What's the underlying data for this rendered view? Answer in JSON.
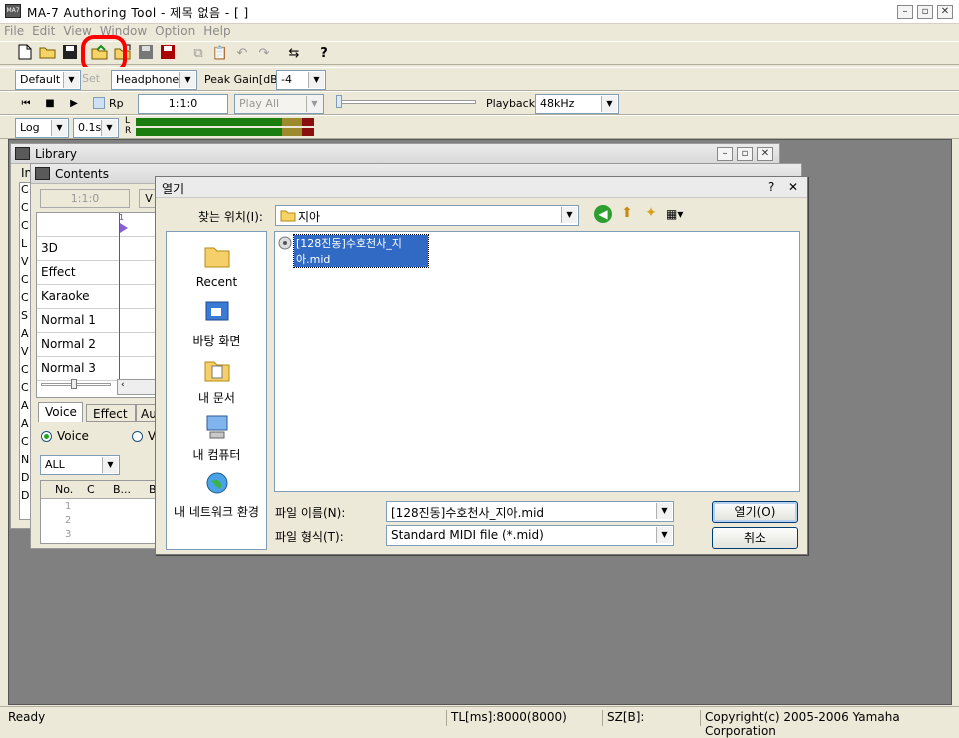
{
  "app": {
    "title": "MA-7 Authoring Tool - 제목 없음 - [ ]",
    "icon": "app-icon"
  },
  "menu": [
    "File",
    "Edit",
    "View",
    "Window",
    "Option",
    "Help"
  ],
  "toolbar2": {
    "mode": "Default",
    "set_label": "Set",
    "output": "Headphone",
    "peak_gain_label": "Peak Gain[dB]",
    "peak_gain_value": "-4"
  },
  "toolbar3": {
    "rp_label": "Rp",
    "position": "1:1:0",
    "play_mode": "Play All",
    "playback_label": "Playback",
    "sample_rate": "48kHz"
  },
  "toolbar4": {
    "scale": "Log",
    "interval": "0.1s",
    "left_channel": "L",
    "right_channel": "R"
  },
  "library": {
    "title": "Library",
    "tab_prefix": "In",
    "side_letters": [
      "C",
      "C",
      "C",
      "L",
      "V",
      "C",
      "C",
      "S",
      "A",
      "V",
      "C",
      "C",
      "A",
      "A",
      "C",
      "N",
      "D",
      "D"
    ]
  },
  "contents": {
    "title": "Contents",
    "position": "1:1:0",
    "btn_prefix": "V",
    "ruler_mark": "1",
    "rows": [
      "",
      "3D",
      "Effect",
      "Karaoke",
      "Normal 1",
      "Normal 2",
      "Normal 3"
    ],
    "tabs": [
      "Voice",
      "Effect",
      "Au"
    ],
    "radio_voice": "Voice",
    "radio_other": "V",
    "filter": "ALL",
    "table_headers": [
      "No.",
      "C",
      "B...",
      "B"
    ],
    "table_rows": [
      "1",
      "2",
      "3"
    ]
  },
  "dialog": {
    "title": "열기",
    "lookin_label": "찾는 위치(I):",
    "lookin_value": "지아",
    "places": [
      "Recent",
      "바탕 화면",
      "내 문서",
      "내 컴퓨터",
      "내 네트워크 환경"
    ],
    "file_item": "[128진동]수호천사_지아.mid",
    "filename_label": "파일 이름(N):",
    "filename_value": "[128진동]수호천사_지아.mid",
    "filetype_label": "파일 형식(T):",
    "filetype_value": "Standard MIDI file (*.mid)",
    "open_button": "열기(O)",
    "cancel_button": "취소",
    "help_glyph": "?",
    "close_glyph": "✕"
  },
  "status": {
    "ready": "Ready",
    "tl": "TL[ms]:8000(8000)",
    "sz": "SZ[B]:",
    "copyright": "Copyright(c) 2005-2006 Yamaha Corporation"
  },
  "colors": {
    "highlight_circle": "#ff0000",
    "meter_green": "#1a7d10",
    "meter_olive": "#9c8a2c",
    "meter_red": "#8a1010",
    "selection": "#316ac5"
  }
}
